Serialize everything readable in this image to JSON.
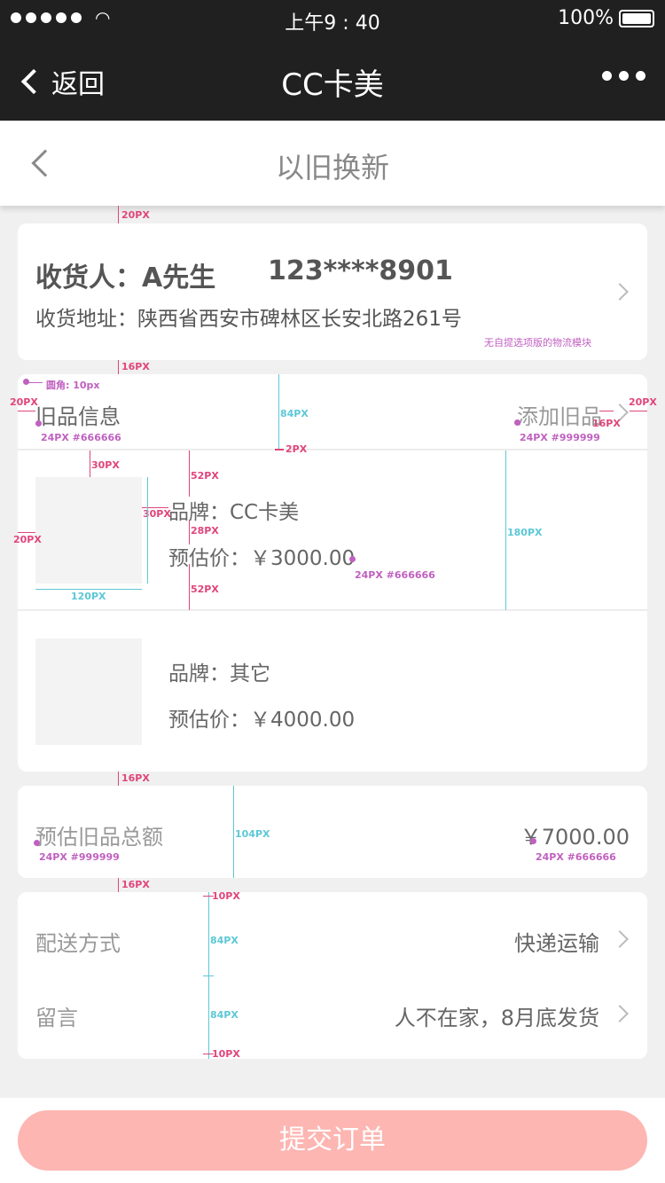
{
  "status_bar": {
    "time": "上午9 : 40",
    "battery": "100%"
  },
  "nav": {
    "back_label": "返回",
    "title": "CC卡美"
  },
  "subheader": {
    "title": "以旧换新"
  },
  "address": {
    "receiver_label": "收货人：",
    "receiver_name": "A先生",
    "phone": "123****8901",
    "address_label": "收货地址：",
    "address_value": "陕西省西安市碑林区长安北路261号",
    "note": "无自提选项版的物流模块"
  },
  "old_items": {
    "title": "旧品信息",
    "add_label": "添加旧品",
    "items": [
      {
        "brand_label": "品牌：",
        "brand": "CC卡美",
        "price_label": "预估价：",
        "price": "￥3000.00"
      },
      {
        "brand_label": "品牌：",
        "brand": "其它",
        "price_label": "预估价：",
        "price": "￥4000.00"
      }
    ]
  },
  "total": {
    "label": "预估旧品总额",
    "value": "￥7000.00"
  },
  "delivery": {
    "method_label": "配送方式",
    "method_value": "快递运输",
    "message_label": "留言",
    "message_value": "人不在家，8月底发货"
  },
  "submit_label": "提交订单",
  "annotations": {
    "gap_20": "20PX",
    "gap_16a": "16PX",
    "radius": "圆角: 10px",
    "pad_left": "20PX",
    "spec_title": "24PX #666666",
    "spec_add": "24PX #999999",
    "h84": "84PX",
    "line2": "2PX",
    "pad_right16": "16PX",
    "pad_right20": "20PX",
    "m30_top": "30PX",
    "m52_top": "52PX",
    "m30_left": "30PX",
    "m28": "28PX",
    "m52_bottom": "52PX",
    "m20_left": "20PX",
    "w120": "120PX",
    "h180": "180PX",
    "spec_price": "24PX #666666",
    "gap_16b": "16PX",
    "h104": "104PX",
    "spec_total_label": "24PX #999999",
    "spec_total_value": "24PX #666666",
    "gap_16c": "16PX",
    "m10_top": "10PX",
    "h84a": "84PX",
    "h84b": "84PX",
    "m10_bottom": "10PX"
  },
  "colors": {
    "nav_bg": "#202020",
    "submit_bg": "#fdb6b2",
    "annotation_pink": "#e0457b",
    "annotation_cyan": "#5cc8d6"
  }
}
